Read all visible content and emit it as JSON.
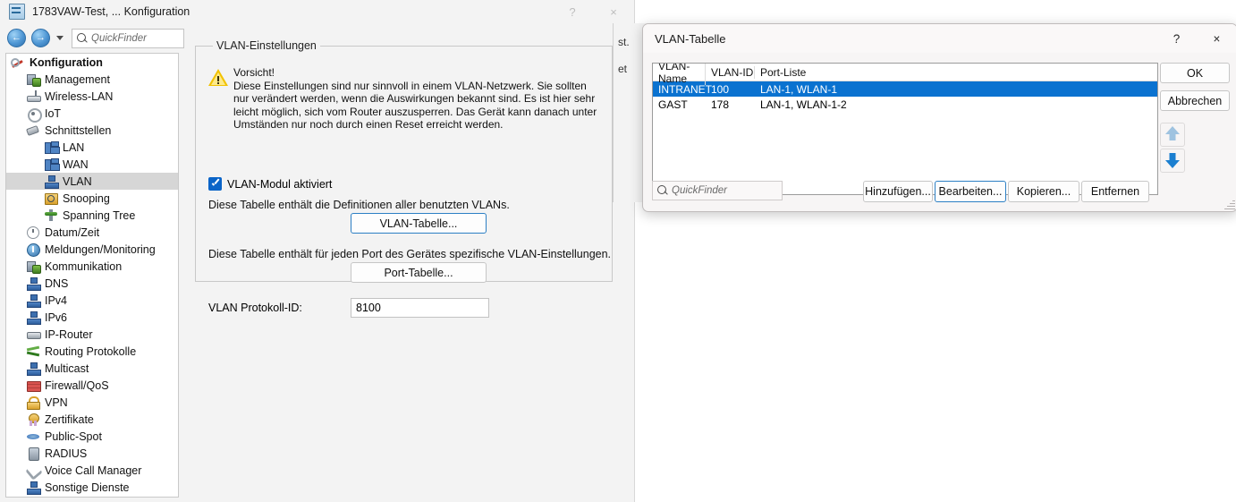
{
  "main_window": {
    "title": "1783VAW-Test, ... Konfiguration",
    "app_icon": "config-app-icon",
    "help_button": "?",
    "close_button": "×",
    "toolbar": {
      "back_icon": "←",
      "forward_icon": "→",
      "dropdown_icon": "chevron-down-icon",
      "quickfinder_placeholder": "QuickFinder",
      "search_icon": "search-icon"
    }
  },
  "sidebar": {
    "items": [
      {
        "label": "Konfiguration",
        "level": 0,
        "icon": "wrench-icon",
        "selected": false
      },
      {
        "label": "Management",
        "level": 1,
        "icon": "management-icon",
        "selected": false
      },
      {
        "label": "Wireless-LAN",
        "level": 1,
        "icon": "wireless-lan-icon",
        "selected": false
      },
      {
        "label": "IoT",
        "level": 1,
        "icon": "gear-icon",
        "selected": false
      },
      {
        "label": "Schnittstellen",
        "level": 1,
        "icon": "interfaces-icon",
        "selected": false
      },
      {
        "label": "LAN",
        "level": 2,
        "icon": "lan-icon",
        "selected": false
      },
      {
        "label": "WAN",
        "level": 2,
        "icon": "wan-icon",
        "selected": false
      },
      {
        "label": "VLAN",
        "level": 2,
        "icon": "vlan-icon",
        "selected": true
      },
      {
        "label": "Snooping",
        "level": 2,
        "icon": "snooping-icon",
        "selected": false
      },
      {
        "label": "Spanning Tree",
        "level": 2,
        "icon": "spanning-tree-icon",
        "selected": false
      },
      {
        "label": "Datum/Zeit",
        "level": 1,
        "icon": "clock-icon",
        "selected": false
      },
      {
        "label": "Meldungen/Monitoring",
        "level": 1,
        "icon": "info-icon",
        "selected": false
      },
      {
        "label": "Kommunikation",
        "level": 1,
        "icon": "communication-icon",
        "selected": false
      },
      {
        "label": "DNS",
        "level": 1,
        "icon": "dns-icon",
        "selected": false
      },
      {
        "label": "IPv4",
        "level": 1,
        "icon": "ipv4-icon",
        "selected": false
      },
      {
        "label": "IPv6",
        "level": 1,
        "icon": "ipv6-icon",
        "selected": false
      },
      {
        "label": "IP-Router",
        "level": 1,
        "icon": "router-icon",
        "selected": false
      },
      {
        "label": "Routing Protokolle",
        "level": 1,
        "icon": "routing-icon",
        "selected": false
      },
      {
        "label": "Multicast",
        "level": 1,
        "icon": "multicast-icon",
        "selected": false
      },
      {
        "label": "Firewall/QoS",
        "level": 1,
        "icon": "firewall-icon",
        "selected": false
      },
      {
        "label": "VPN",
        "level": 1,
        "icon": "lock-icon",
        "selected": false
      },
      {
        "label": "Zertifikate",
        "level": 1,
        "icon": "certificate-icon",
        "selected": false
      },
      {
        "label": "Public-Spot",
        "level": 1,
        "icon": "public-spot-icon",
        "selected": false
      },
      {
        "label": "RADIUS",
        "level": 1,
        "icon": "radius-icon",
        "selected": false
      },
      {
        "label": "Voice Call Manager",
        "level": 1,
        "icon": "voice-icon",
        "selected": false
      },
      {
        "label": "Sonstige Dienste",
        "level": 1,
        "icon": "services-icon",
        "selected": false
      }
    ]
  },
  "content": {
    "group_title": "VLAN-Einstellungen",
    "warning": {
      "icon": "warning-icon",
      "title": "Vorsicht!",
      "body": "Diese Einstellungen sind nur sinnvoll in einem VLAN-Netzwerk. Sie sollten nur verändert werden, wenn die Auswirkungen bekannt sind. Es ist hier sehr leicht möglich, sich vom Router auszusperren. Das Gerät kann danach unter Umständen nur noch durch einen Reset erreicht werden."
    },
    "vlan_module_checkbox": {
      "label": "VLAN-Modul aktiviert",
      "checked": true
    },
    "table_description": "Diese Tabelle enthält die Definitionen aller benutzten VLANs.",
    "vlan_table_button": "VLAN-Tabelle...",
    "port_description": "Diese Tabelle enthält für jeden Port des Gerätes spezifische VLAN-Einstellungen.",
    "port_table_button": "Port-Tabelle...",
    "protocol_id_label": "VLAN Protokoll-ID:",
    "protocol_id_value": "8100"
  },
  "behind_window": {
    "fragment_1": "st.",
    "fragment_2": "et"
  },
  "dialog": {
    "title": "VLAN-Tabelle",
    "help_button": "?",
    "close_button": "×",
    "table": {
      "columns": [
        "VLAN-Name",
        "VLAN-ID",
        "Port-Liste"
      ],
      "rows": [
        {
          "name": "INTRANET",
          "id": "100",
          "ports": "LAN-1, WLAN-1",
          "selected": true
        },
        {
          "name": "GAST",
          "id": "178",
          "ports": "LAN-1, WLAN-1-2",
          "selected": false
        }
      ]
    },
    "ok_button": "OK",
    "cancel_button": "Abbrechen",
    "move_up_icon": "arrow-up-icon",
    "move_down_icon": "arrow-down-icon",
    "quickfinder_placeholder": "QuickFinder",
    "search_icon": "search-icon",
    "buttons": [
      {
        "label": "Hinzufügen...",
        "focused": false
      },
      {
        "label": "Bearbeiten...",
        "focused": true
      },
      {
        "label": "Kopieren...",
        "focused": false
      },
      {
        "label": "Entfernen",
        "focused": false
      }
    ]
  },
  "colors": {
    "selection_blue": "#0a72d0",
    "focus_border": "#2c7fc4",
    "checkbox_blue": "#0a64c8",
    "window_bg": "#f3f3f3",
    "dialog_bg": "#f7f5f5"
  }
}
